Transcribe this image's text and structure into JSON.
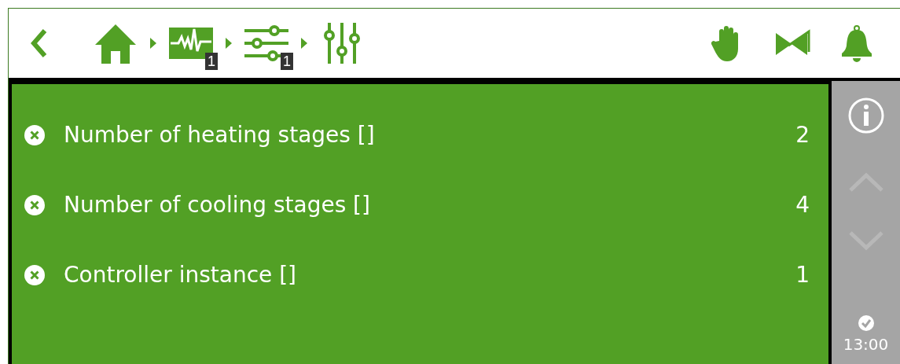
{
  "breadcrumb": [
    {
      "kind": "home"
    },
    {
      "kind": "trend",
      "badge": "1"
    },
    {
      "kind": "filter",
      "badge": "1"
    },
    {
      "kind": "sliders"
    }
  ],
  "toolbar": [
    {
      "kind": "hand"
    },
    {
      "kind": "valve"
    },
    {
      "kind": "bell"
    }
  ],
  "parameters": [
    {
      "label": "Number of heating stages []",
      "value": "2"
    },
    {
      "label": "Number of cooling stages []",
      "value": "4"
    },
    {
      "label": "Controller instance []",
      "value": "1"
    }
  ],
  "sidebar": {
    "scroll_up": {
      "disabled": true
    },
    "scroll_down": {
      "disabled": true
    },
    "time": "13:00"
  }
}
